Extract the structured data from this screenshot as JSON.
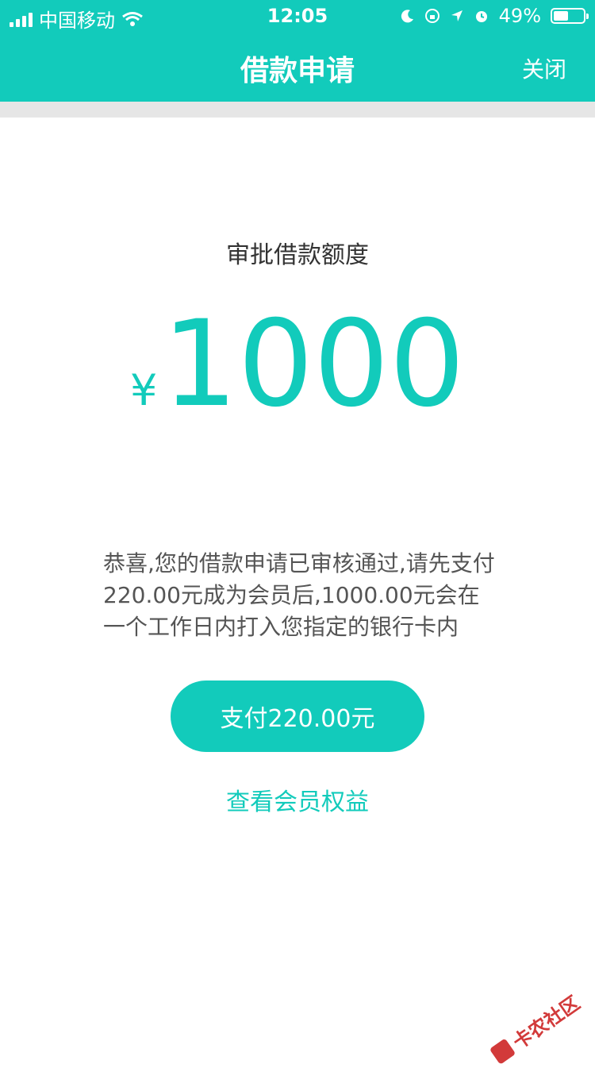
{
  "status_bar": {
    "carrier": "中国移动",
    "time": "12:05",
    "battery": "49%"
  },
  "header": {
    "title": "借款申请",
    "close_label": "关闭"
  },
  "amount": {
    "label": "审批借款额度",
    "currency": "¥",
    "value": "1000"
  },
  "message": "恭喜,您的借款申请已审核通过,请先支付220.00元成为会员后,1000.00元会在一个工作日内打入您指定的银行卡内",
  "pay_button": "支付220.00元",
  "benefits_link": "查看会员权益",
  "watermark": "卡农社区",
  "colors": {
    "accent": "#12cbbb",
    "text": "#333333",
    "muted": "#555555",
    "divider": "#e6e6e6"
  }
}
